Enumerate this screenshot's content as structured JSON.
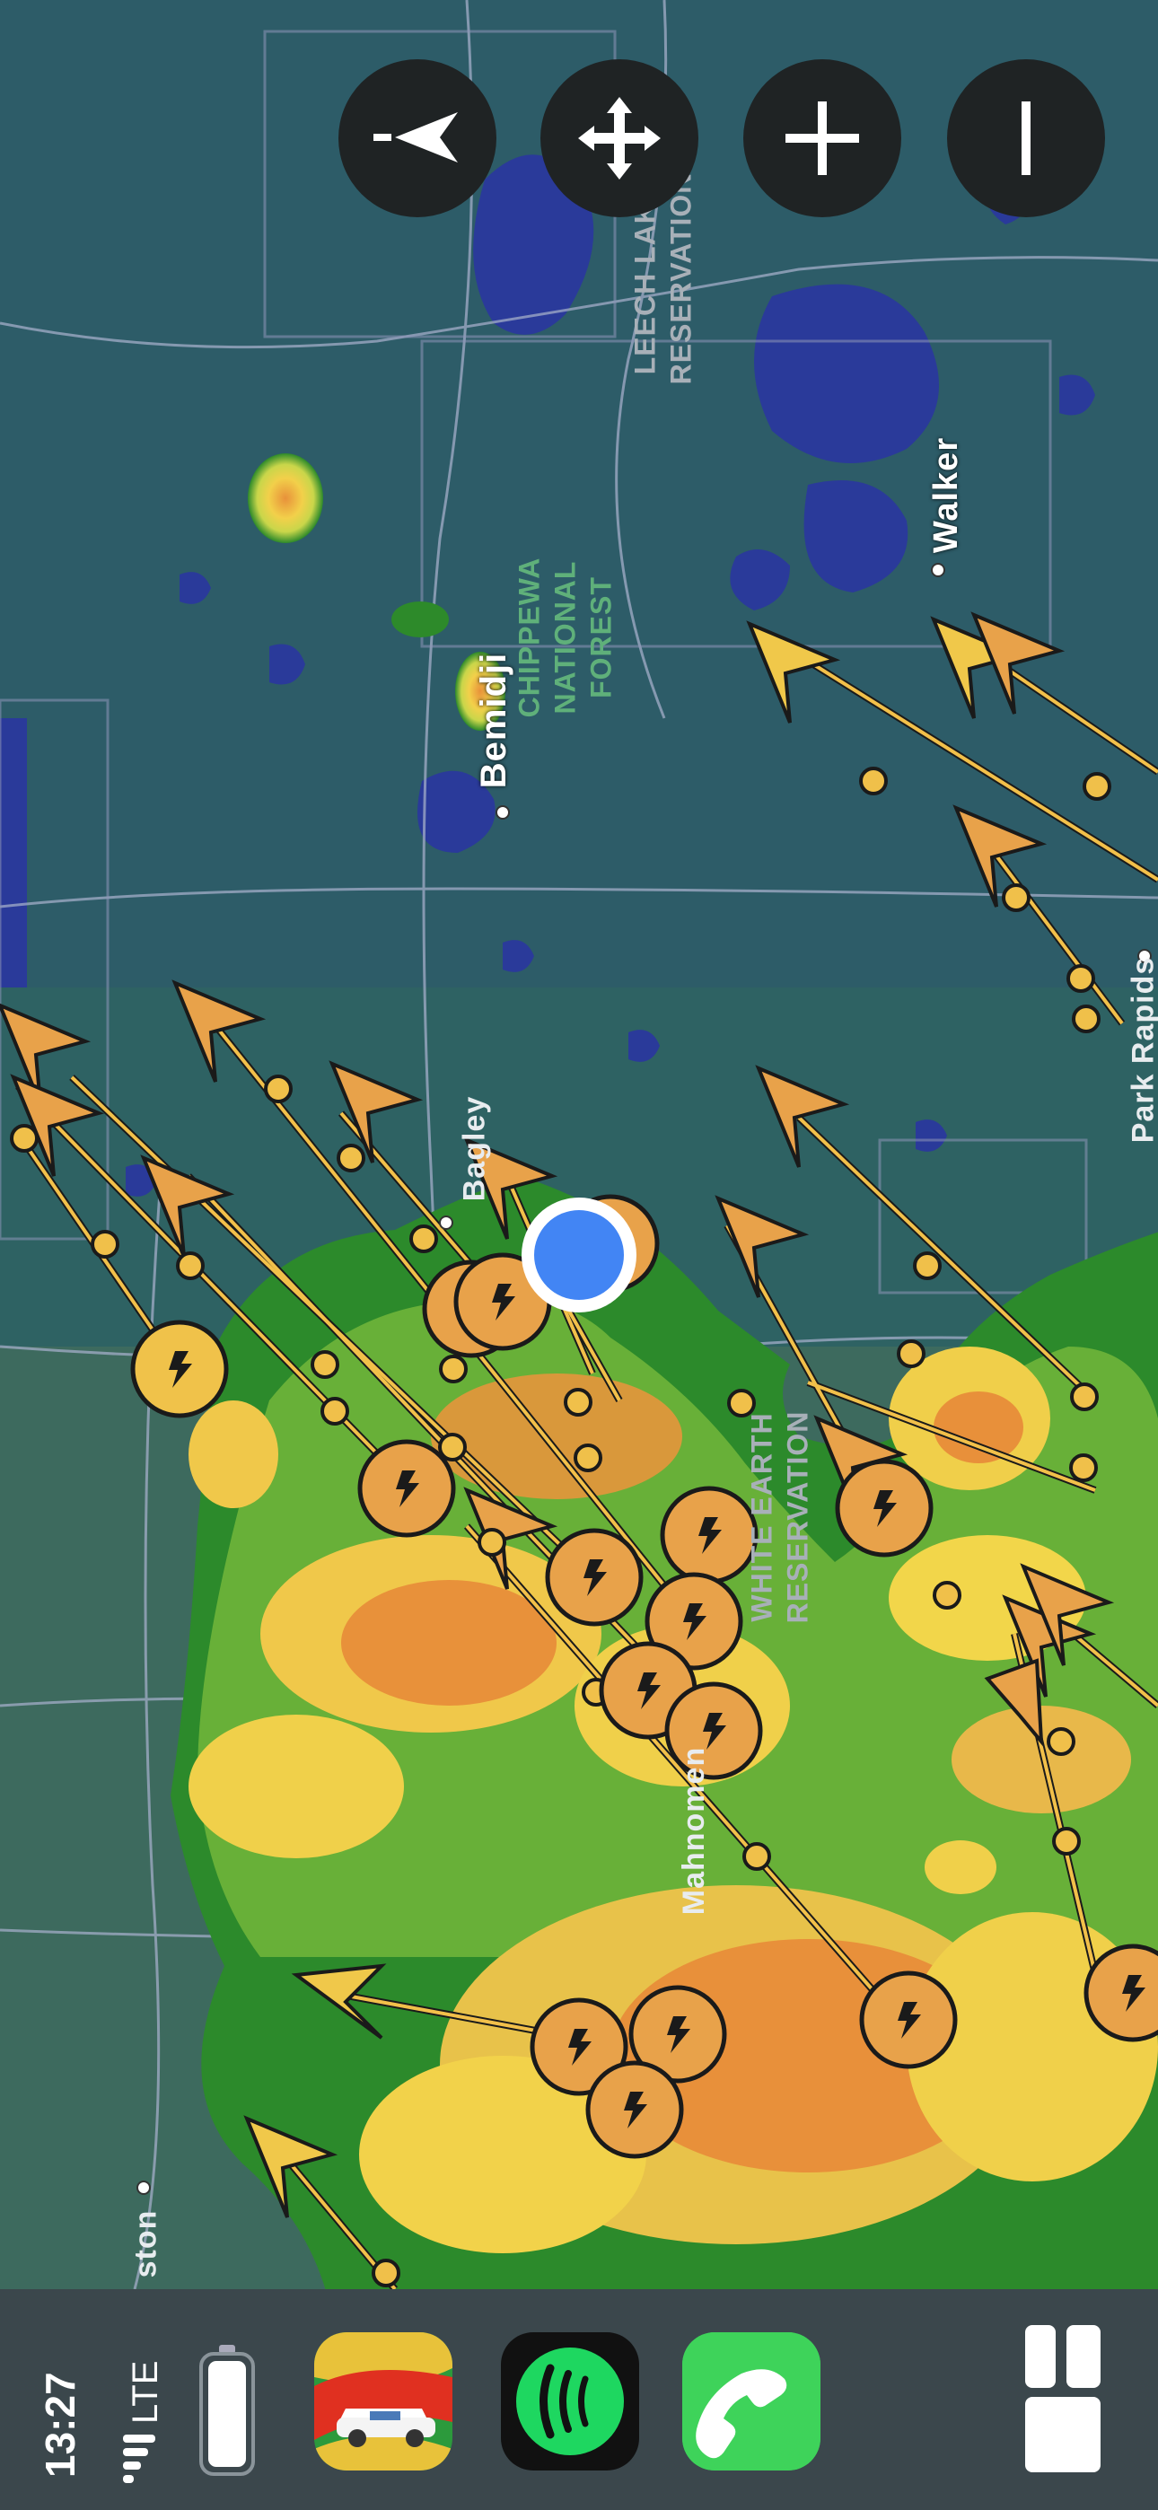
{
  "map": {
    "places": [
      {
        "name": "Bemidji",
        "color": "#ffffff"
      },
      {
        "name": "Walker",
        "color": "#ffffff"
      },
      {
        "name": "Bagley",
        "color": "#e8ecef"
      },
      {
        "name": "Park Rapids",
        "color": "#e8ecef"
      },
      {
        "name": "Mahnomen",
        "color": "#e8ecef"
      },
      {
        "name": "ston",
        "color": "#e8ecef"
      }
    ],
    "regions": [
      {
        "line1": "CHIPPEWA",
        "line2": "NATIONAL",
        "line3": "FOREST",
        "color": "#5fb07a"
      },
      {
        "line1": "LEECH LAKE",
        "line2": "RESERVATION",
        "color": "#a8b0b8"
      },
      {
        "line1": "WHITE EARTH",
        "line2": "RESERVATION",
        "color": "#a8b0b8"
      }
    ],
    "colors": {
      "radar_green": "#2d8a2a",
      "radar_yellow": "#f2e14a",
      "radar_orange": "#e89a3a",
      "storm_marker": "#e8a24a",
      "lightning_marker": "#f0c24a",
      "location_dot": "#4285f4"
    }
  },
  "controls": [
    {
      "name": "location-arrow-icon",
      "label": "-<"
    },
    {
      "name": "pan-icon",
      "label": "move"
    },
    {
      "name": "zoom-in-icon",
      "label": "+"
    },
    {
      "name": "zoom-out-icon",
      "label": "-"
    }
  ],
  "status": {
    "time": "13:27",
    "network": "LTE"
  },
  "dock": {
    "apps": [
      {
        "name": "weather-radar-app-icon"
      },
      {
        "name": "spotify-app-icon"
      },
      {
        "name": "phone-app-icon"
      }
    ],
    "dashboard": "dashboard-toggle-icon"
  }
}
